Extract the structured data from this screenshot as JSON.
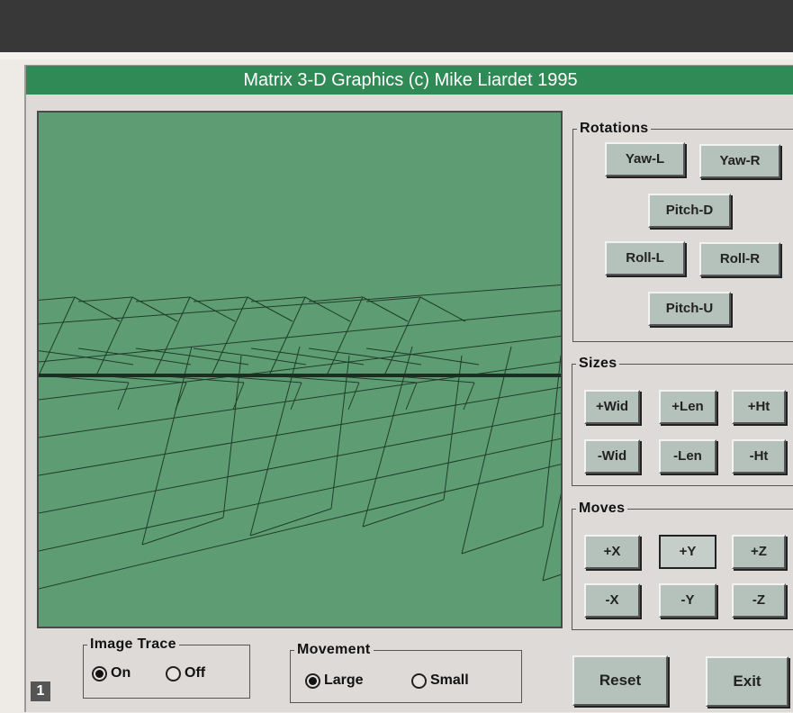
{
  "window": {
    "title": "Matrix 3-D Graphics (c) Mike Liardet 1995"
  },
  "rotations": {
    "legend": "Rotations",
    "yaw_left": "Yaw-L",
    "yaw_right": "Yaw-R",
    "pitch_down": "Pitch-D",
    "roll_left": "Roll-L",
    "roll_right": "Roll-R",
    "pitch_up": "Pitch-U"
  },
  "sizes": {
    "legend": "Sizes",
    "plus_wid": "+Wid",
    "plus_len": "+Len",
    "plus_ht": "+Ht",
    "minus_wid": "-Wid",
    "minus_len": "-Len",
    "minus_ht": "-Ht"
  },
  "moves": {
    "legend": "Moves",
    "plus_x": "+X",
    "plus_y": "+Y",
    "plus_z": "+Z",
    "minus_x": "-X",
    "minus_y": "-Y",
    "minus_z": "-Z"
  },
  "image_trace": {
    "legend": "Image Trace",
    "on": "On",
    "off": "Off",
    "selected": "On"
  },
  "movement": {
    "legend": "Movement",
    "large": "Large",
    "small": "Small",
    "selected": "Large"
  },
  "actions": {
    "reset": "Reset",
    "exit": "Exit"
  },
  "page_badge": "1",
  "colors": {
    "viewport": "#5e9d73",
    "titlebar": "#2f8a55",
    "button": "#b5c1bb"
  }
}
